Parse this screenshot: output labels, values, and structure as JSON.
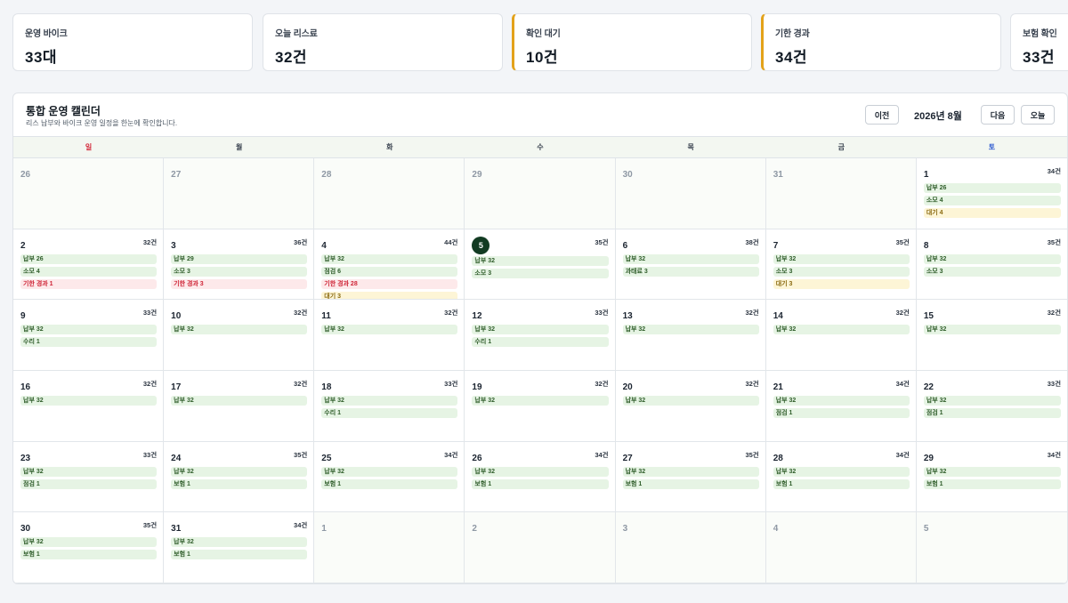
{
  "stats": [
    {
      "label": "운영 바이크",
      "value": "33대",
      "warn": false
    },
    {
      "label": "오늘 리스료",
      "value": "32건",
      "warn": false
    },
    {
      "label": "확인 대기",
      "value": "10건",
      "warn": true
    },
    {
      "label": "기한 경과",
      "value": "34건",
      "warn": true
    },
    {
      "label": "보험 확인",
      "value": "33건",
      "warn": false
    }
  ],
  "calendar": {
    "title": "통합 운영 캘린더",
    "subtitle": "리스 납부와 바이크 운영 일정을 한눈에 확인합니다.",
    "prev_label": "이전",
    "month_label": "2026년 8월",
    "next_label": "다음",
    "today_label": "오늘",
    "weekdays": [
      {
        "label": "일",
        "kind": "sun"
      },
      {
        "label": "월",
        "kind": ""
      },
      {
        "label": "화",
        "kind": ""
      },
      {
        "label": "수",
        "kind": ""
      },
      {
        "label": "목",
        "kind": ""
      },
      {
        "label": "금",
        "kind": ""
      },
      {
        "label": "토",
        "kind": "sat"
      }
    ],
    "days": [
      {
        "day": "26",
        "other": true,
        "count": "",
        "events": []
      },
      {
        "day": "27",
        "other": true,
        "count": "",
        "events": []
      },
      {
        "day": "28",
        "other": true,
        "count": "",
        "events": []
      },
      {
        "day": "29",
        "other": true,
        "count": "",
        "events": []
      },
      {
        "day": "30",
        "other": true,
        "count": "",
        "events": []
      },
      {
        "day": "31",
        "other": true,
        "count": "",
        "events": []
      },
      {
        "day": "1",
        "count": "34건",
        "events": [
          {
            "text": "납부 26",
            "color": "green"
          },
          {
            "text": "소모 4",
            "color": "green"
          },
          {
            "text": "대기 4",
            "color": "yellow"
          }
        ]
      },
      {
        "day": "2",
        "count": "32건",
        "events": [
          {
            "text": "납부 26",
            "color": "green"
          },
          {
            "text": "소모 4",
            "color": "green"
          },
          {
            "text": "기한 경과 1",
            "color": "red"
          }
        ]
      },
      {
        "day": "3",
        "count": "36건",
        "events": [
          {
            "text": "납부 29",
            "color": "green"
          },
          {
            "text": "소모 3",
            "color": "green"
          },
          {
            "text": "기한 경과 3",
            "color": "red"
          }
        ]
      },
      {
        "day": "4",
        "count": "44건",
        "events": [
          {
            "text": "납부 32",
            "color": "green"
          },
          {
            "text": "점검 6",
            "color": "green"
          },
          {
            "text": "기한 경과 28",
            "color": "red"
          },
          {
            "text": "대기 3",
            "color": "yellow"
          }
        ]
      },
      {
        "day": "5",
        "today": true,
        "count": "35건",
        "events": [
          {
            "text": "납부 32",
            "color": "green"
          },
          {
            "text": "소모 3",
            "color": "green"
          }
        ]
      },
      {
        "day": "6",
        "count": "38건",
        "events": [
          {
            "text": "납부 32",
            "color": "green"
          },
          {
            "text": "과태료 3",
            "color": "green"
          }
        ]
      },
      {
        "day": "7",
        "count": "35건",
        "events": [
          {
            "text": "납부 32",
            "color": "green"
          },
          {
            "text": "소모 3",
            "color": "green"
          },
          {
            "text": "대기 3",
            "color": "yellow"
          }
        ]
      },
      {
        "day": "8",
        "count": "35건",
        "events": [
          {
            "text": "납부 32",
            "color": "green"
          },
          {
            "text": "소모 3",
            "color": "green"
          }
        ]
      },
      {
        "day": "9",
        "count": "33건",
        "events": [
          {
            "text": "납부 32",
            "color": "green"
          },
          {
            "text": "수리 1",
            "color": "green"
          }
        ]
      },
      {
        "day": "10",
        "count": "32건",
        "events": [
          {
            "text": "납부 32",
            "color": "green"
          }
        ]
      },
      {
        "day": "11",
        "count": "32건",
        "events": [
          {
            "text": "납부 32",
            "color": "green"
          }
        ]
      },
      {
        "day": "12",
        "count": "33건",
        "events": [
          {
            "text": "납부 32",
            "color": "green"
          },
          {
            "text": "수리 1",
            "color": "green"
          }
        ]
      },
      {
        "day": "13",
        "count": "32건",
        "events": [
          {
            "text": "납부 32",
            "color": "green"
          }
        ]
      },
      {
        "day": "14",
        "count": "32건",
        "events": [
          {
            "text": "납부 32",
            "color": "green"
          }
        ]
      },
      {
        "day": "15",
        "count": "32건",
        "events": [
          {
            "text": "납부 32",
            "color": "green"
          }
        ]
      },
      {
        "day": "16",
        "count": "32건",
        "events": [
          {
            "text": "납부 32",
            "color": "green"
          }
        ]
      },
      {
        "day": "17",
        "count": "32건",
        "events": [
          {
            "text": "납부 32",
            "color": "green"
          }
        ]
      },
      {
        "day": "18",
        "count": "33건",
        "events": [
          {
            "text": "납부 32",
            "color": "green"
          },
          {
            "text": "수리 1",
            "color": "green"
          }
        ]
      },
      {
        "day": "19",
        "count": "32건",
        "events": [
          {
            "text": "납부 32",
            "color": "green"
          }
        ]
      },
      {
        "day": "20",
        "count": "32건",
        "events": [
          {
            "text": "납부 32",
            "color": "green"
          }
        ]
      },
      {
        "day": "21",
        "count": "34건",
        "events": [
          {
            "text": "납부 32",
            "color": "green"
          },
          {
            "text": "점검 1",
            "color": "green"
          }
        ]
      },
      {
        "day": "22",
        "count": "33건",
        "events": [
          {
            "text": "납부 32",
            "color": "green"
          },
          {
            "text": "점검 1",
            "color": "green"
          }
        ]
      },
      {
        "day": "23",
        "count": "33건",
        "events": [
          {
            "text": "납부 32",
            "color": "green"
          },
          {
            "text": "점검 1",
            "color": "green"
          }
        ]
      },
      {
        "day": "24",
        "count": "35건",
        "events": [
          {
            "text": "납부 32",
            "color": "green"
          },
          {
            "text": "보험 1",
            "color": "green"
          }
        ]
      },
      {
        "day": "25",
        "count": "34건",
        "events": [
          {
            "text": "납부 32",
            "color": "green"
          },
          {
            "text": "보험 1",
            "color": "green"
          }
        ]
      },
      {
        "day": "26",
        "count": "34건",
        "events": [
          {
            "text": "납부 32",
            "color": "green"
          },
          {
            "text": "보험 1",
            "color": "green"
          }
        ]
      },
      {
        "day": "27",
        "count": "35건",
        "events": [
          {
            "text": "납부 32",
            "color": "green"
          },
          {
            "text": "보험 1",
            "color": "green"
          }
        ]
      },
      {
        "day": "28",
        "count": "34건",
        "events": [
          {
            "text": "납부 32",
            "color": "green"
          },
          {
            "text": "보험 1",
            "color": "green"
          }
        ]
      },
      {
        "day": "29",
        "count": "34건",
        "events": [
          {
            "text": "납부 32",
            "color": "green"
          },
          {
            "text": "보험 1",
            "color": "green"
          }
        ]
      },
      {
        "day": "30",
        "count": "35건",
        "events": [
          {
            "text": "납부 32",
            "color": "green"
          },
          {
            "text": "보험 1",
            "color": "green"
          }
        ]
      },
      {
        "day": "31",
        "count": "34건",
        "events": [
          {
            "text": "납부 32",
            "color": "green"
          },
          {
            "text": "보험 1",
            "color": "green"
          }
        ]
      },
      {
        "day": "1",
        "other": true,
        "count": "",
        "events": []
      },
      {
        "day": "2",
        "other": true,
        "count": "",
        "events": []
      },
      {
        "day": "3",
        "other": true,
        "count": "",
        "events": []
      },
      {
        "day": "4",
        "other": true,
        "count": "",
        "events": []
      },
      {
        "day": "5",
        "other": true,
        "count": "",
        "events": []
      }
    ]
  }
}
